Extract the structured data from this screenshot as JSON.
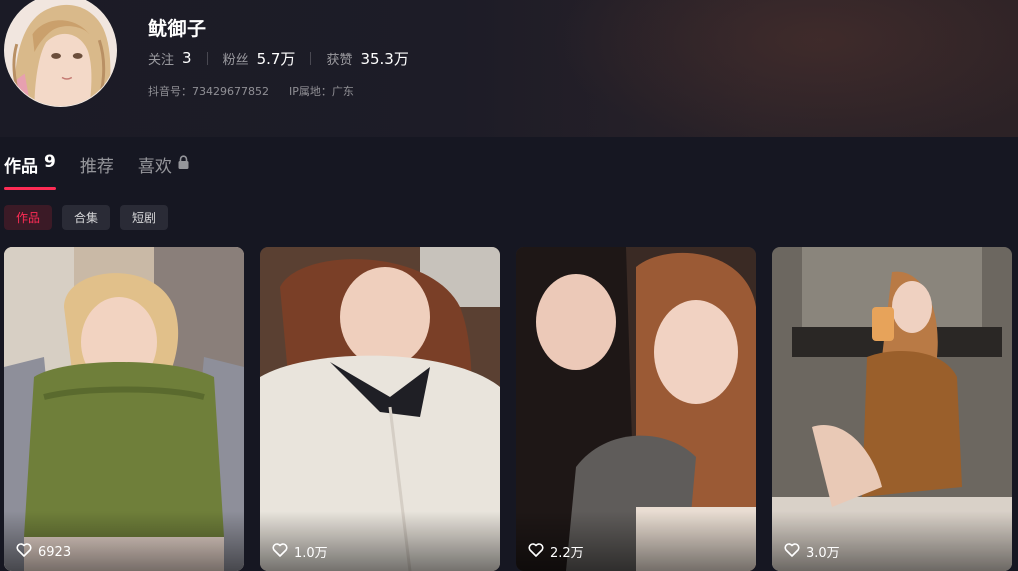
{
  "profile": {
    "nickname": "鱿御子",
    "stats": [
      {
        "label": "关注",
        "value": "3"
      },
      {
        "label": "粉丝",
        "value": "5.7万"
      },
      {
        "label": "获赞",
        "value": "35.3万"
      }
    ],
    "douyin_id": "抖音号：73429677852",
    "ip_location": "IP属地：广东"
  },
  "tabs": [
    {
      "label": "作品",
      "count": "9",
      "active": true
    },
    {
      "label": "推荐",
      "active": false
    },
    {
      "label": "喜欢",
      "locked": true,
      "icon": "lock-icon",
      "active": false
    }
  ],
  "filter_chips": [
    {
      "label": "作品",
      "active": true
    },
    {
      "label": "合集",
      "active": false
    },
    {
      "label": "短剧",
      "active": false
    }
  ],
  "videos": [
    {
      "likes": "6923",
      "icon": "heart-icon"
    },
    {
      "likes": "1.0万",
      "icon": "heart-icon"
    },
    {
      "likes": "2.2万",
      "icon": "heart-icon"
    },
    {
      "likes": "3.0万",
      "icon": "heart-icon"
    }
  ],
  "colors": {
    "background": "#161722",
    "accent": "#fe2c55",
    "chip_bg": "#2a2b36"
  }
}
